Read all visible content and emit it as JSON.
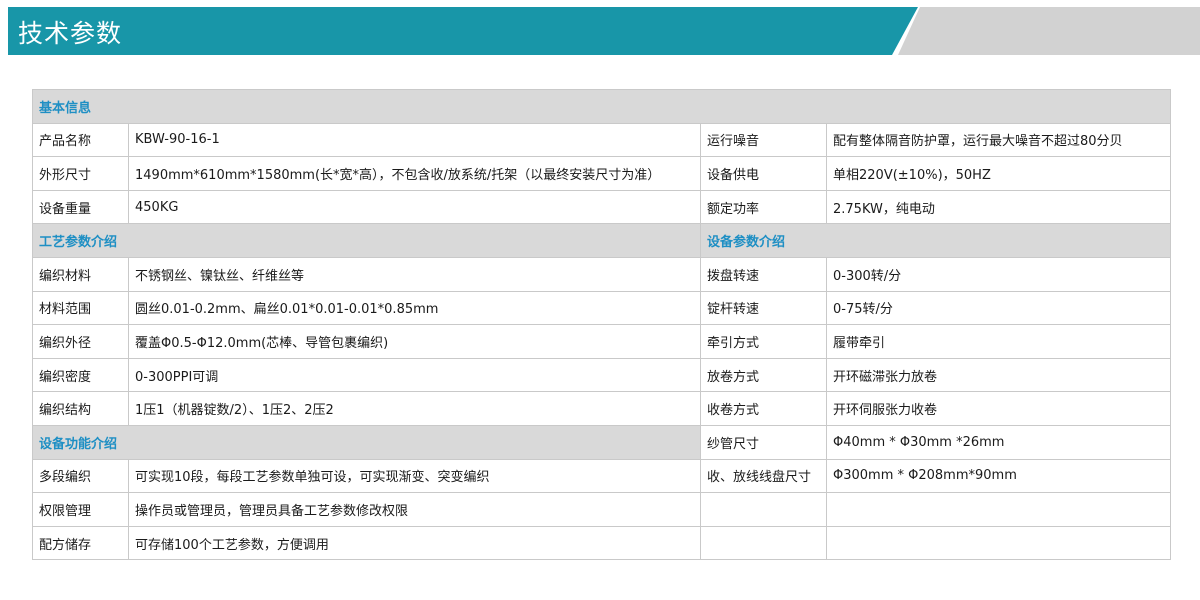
{
  "header": {
    "title": "技术参数"
  },
  "sections": {
    "basic": "基本信息",
    "process": "工艺参数介绍",
    "equipment": "设备参数介绍",
    "functions": "设备功能介绍"
  },
  "basic_rows": [
    {
      "label": "产品名称",
      "value": "KBW-90-16-1",
      "label2": "运行噪音",
      "value2": "配有整体隔音防护罩，运行最大噪音不超过80分贝"
    },
    {
      "label": "外形尺寸",
      "value": "1490mm*610mm*1580mm(长*宽*高），不包含收/放系统/托架（以最终安装尺寸为准）",
      "label2": "设备供电",
      "value2": "单相220V(±10%)，50HZ"
    },
    {
      "label": "设备重量",
      "value": "450KG",
      "label2": "额定功率",
      "value2": "2.75KW，纯电动"
    }
  ],
  "process_rows": [
    {
      "label": "编织材料",
      "value": "不锈钢丝、镍钛丝、纤维丝等",
      "label2": "拨盘转速",
      "value2": "0-300转/分"
    },
    {
      "label": "材料范围",
      "value": "圆丝0.01-0.2mm、扁丝0.01*0.01-0.01*0.85mm",
      "label2": "锭杆转速",
      "value2": "0-75转/分"
    },
    {
      "label": "编织外径",
      "value": "覆盖Φ0.5-Φ12.0mm(芯棒、导管包裹编织)",
      "label2": "牵引方式",
      "value2": "履带牵引"
    },
    {
      "label": "编织密度",
      "value": "0-300PPI可调",
      "label2": "放卷方式",
      "value2": "开环磁滞张力放卷"
    },
    {
      "label": "编织结构",
      "value": "1压1（机器锭数/2）、1压2、2压2",
      "label2": "收卷方式",
      "value2": "开环伺服张力收卷"
    }
  ],
  "functions_side": {
    "label2": "纱管尺寸",
    "value2": "Φ40mm * Φ30mm *26mm"
  },
  "function_rows": [
    {
      "label": "多段编织",
      "value": "可实现10段，每段工艺参数单独可设，可实现渐变、突变编织",
      "label2": "收、放线线盘尺寸",
      "value2": "Φ300mm * Φ208mm*90mm"
    },
    {
      "label": "权限管理",
      "value": "操作员或管理员，管理员具备工艺参数修改权限",
      "label2": "",
      "value2": ""
    },
    {
      "label": "配方储存",
      "value": "可存储100个工艺参数，方便调用",
      "label2": "",
      "value2": ""
    }
  ]
}
